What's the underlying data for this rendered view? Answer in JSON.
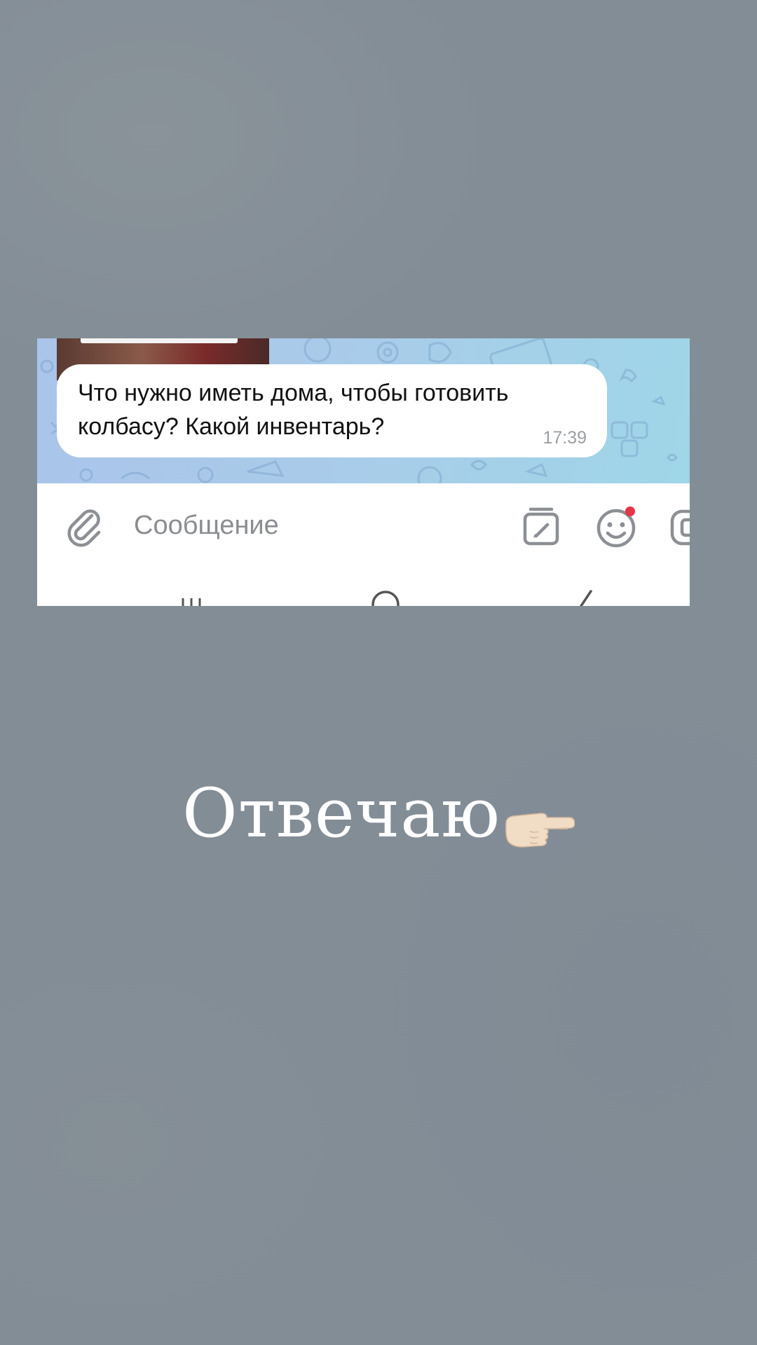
{
  "chat": {
    "message_text": "Что нужно иметь дома, чтобы готовить колбасу? Какой инвентарь?",
    "message_time": "17:39"
  },
  "composer": {
    "placeholder": "Сообщение"
  },
  "icons": {
    "attach": "paperclip-icon",
    "commands": "bot-commands-icon",
    "emoji": "emoji-icon",
    "emoji_badge_color": "#e6354b",
    "voice": "microphone-icon",
    "nav_recent": "recent-apps-icon",
    "nav_home": "home-icon",
    "nav_back": "back-icon"
  },
  "caption": {
    "text": "Отвечаю",
    "emoji": "👉🏻"
  },
  "colors": {
    "background": "#838d96",
    "chat_wallpaper": "#a9cbe9",
    "bubble": "#ffffff"
  }
}
